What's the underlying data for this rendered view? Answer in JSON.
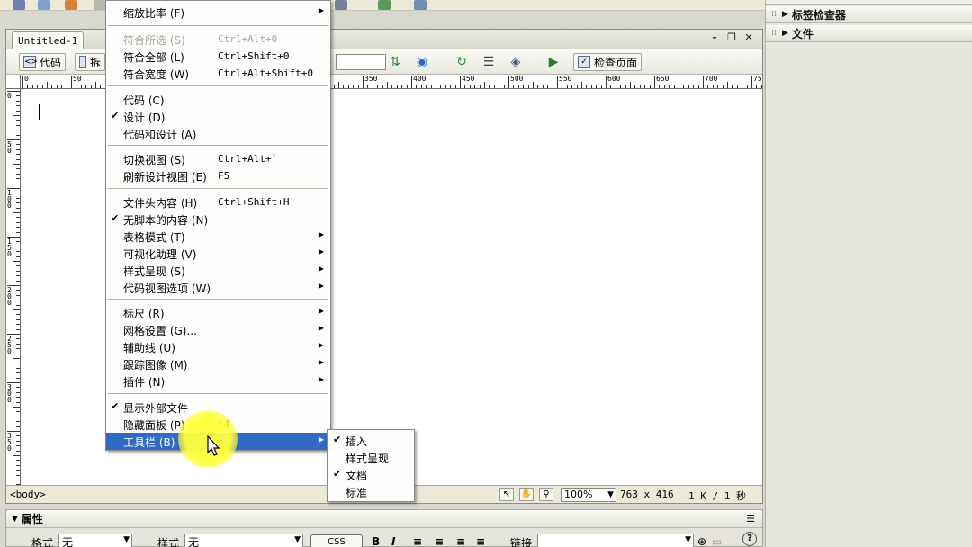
{
  "doc": {
    "tab_title": "Untitled-1",
    "toolbar": {
      "code_label": "代码",
      "split_label": "拆",
      "check_page_label": "检查页面"
    }
  },
  "ruler": {
    "h_labels": [
      "0",
      "50",
      "350",
      "400",
      "450",
      "500",
      "550",
      "600",
      "650",
      "700",
      "750"
    ],
    "v_labels": [
      "0",
      "50",
      "100",
      "150",
      "200",
      "250",
      "300",
      "350"
    ]
  },
  "status_bar": {
    "tag_selector": "<body>",
    "zoom": "100%",
    "window_size": "763 x 416",
    "download_stat": "1 K / 1 秒"
  },
  "right_panel": {
    "panels": [
      {
        "label": "标签检查器"
      },
      {
        "label": "文件"
      }
    ]
  },
  "properties": {
    "title": "属性",
    "format_label": "格式",
    "format_value": "无",
    "style_label": "样式",
    "style_value": "无",
    "css_label": "CSS",
    "bold_label": "B",
    "italic_label": "I",
    "link_label": "链接",
    "help_label": "?"
  },
  "view_menu": {
    "items": [
      {
        "label": "缩放比率",
        "mnemonic": "(F)",
        "shortcut": "",
        "submenu": true
      },
      {
        "label": "符合所选",
        "mnemonic": "(S)",
        "shortcut": "Ctrl+Alt+0",
        "disabled": true
      },
      {
        "label": "符合全部",
        "mnemonic": "(L)",
        "shortcut": "Ctrl+Shift+0"
      },
      {
        "label": "符合宽度",
        "mnemonic": "(W)",
        "shortcut": "Ctrl+Alt+Shift+0"
      },
      {
        "label": "代码",
        "mnemonic": "(C)",
        "shortcut": ""
      },
      {
        "label": "设计",
        "mnemonic": "(D)",
        "shortcut": "",
        "checked": true
      },
      {
        "label": "代码和设计",
        "mnemonic": "(A)",
        "shortcut": ""
      },
      {
        "label": "切换视图",
        "mnemonic": "(S)",
        "shortcut": "Ctrl+Alt+`"
      },
      {
        "label": "刷新设计视图",
        "mnemonic": "(E)",
        "shortcut": "F5"
      },
      {
        "label": "文件头内容",
        "mnemonic": "(H)",
        "shortcut": "Ctrl+Shift+H"
      },
      {
        "label": "无脚本的内容",
        "mnemonic": "(N)",
        "shortcut": "",
        "checked": true
      },
      {
        "label": "表格模式",
        "mnemonic": "(T)",
        "shortcut": "",
        "submenu": true
      },
      {
        "label": "可视化助理",
        "mnemonic": "(V)",
        "shortcut": "",
        "submenu": true
      },
      {
        "label": "样式呈现",
        "mnemonic": "(S)",
        "shortcut": "",
        "submenu": true
      },
      {
        "label": "代码视图选项",
        "mnemonic": "(W)",
        "shortcut": "",
        "submenu": true
      },
      {
        "label": "标尺",
        "mnemonic": "(R)",
        "shortcut": "",
        "submenu": true
      },
      {
        "label": "网格设置",
        "mnemonic": "(G)...",
        "shortcut": "",
        "submenu": true
      },
      {
        "label": "辅助线",
        "mnemonic": "(U)",
        "shortcut": "",
        "submenu": true
      },
      {
        "label": "跟踪图像",
        "mnemonic": "(M)",
        "shortcut": "",
        "submenu": true
      },
      {
        "label": "插件",
        "mnemonic": "(N)",
        "shortcut": "",
        "submenu": true
      },
      {
        "label": "显示外部文件",
        "mnemonic": "",
        "shortcut": "",
        "checked": true
      },
      {
        "label": "隐藏面板",
        "mnemonic": "(P)",
        "shortcut": "F4"
      },
      {
        "label": "工具栏",
        "mnemonic": "(B)",
        "shortcut": "",
        "submenu": true,
        "highlighted": true
      }
    ]
  },
  "toolbar_submenu": {
    "items": [
      {
        "label": "插入",
        "checked": true
      },
      {
        "label": "样式呈现",
        "checked": false
      },
      {
        "label": "文档",
        "checked": true
      },
      {
        "label": "标准",
        "checked": false
      }
    ]
  },
  "colors": {
    "menu_highlight": "#316ac5",
    "cursor_halo": "#ffff3c"
  }
}
